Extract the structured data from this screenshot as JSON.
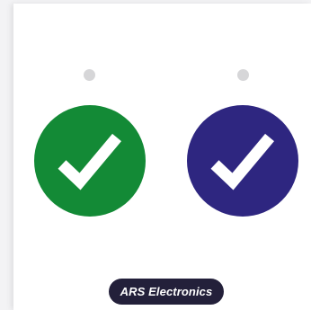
{
  "colors": {
    "green": "#138a36",
    "indigo": "#2e2680",
    "dot": "#d6d6d8",
    "badge_bg": "#23203a"
  },
  "slides": [
    {
      "icon": "check-circle-icon",
      "color": "#138a36"
    },
    {
      "icon": "check-circle-icon",
      "color": "#2e2680"
    }
  ],
  "badge": {
    "label": "ARS Electronics"
  }
}
